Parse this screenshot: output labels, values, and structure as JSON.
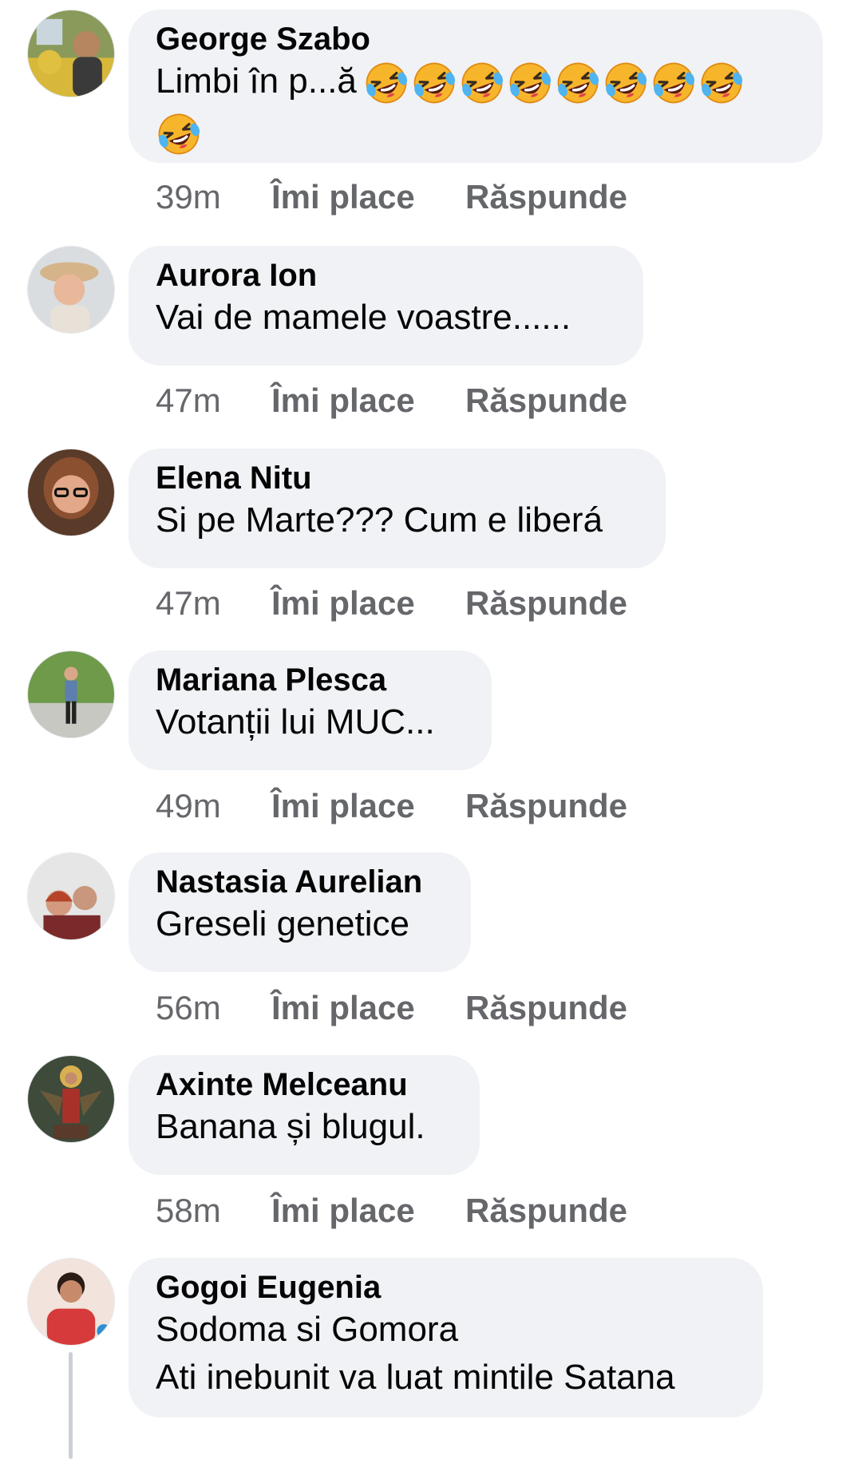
{
  "comments": [
    {
      "author": "George Szabo",
      "text": "Limbi în p...ă",
      "emoji_icon": "rolling-on-floor-laughing-emoji",
      "emoji_count": 9,
      "time": "39m",
      "like_label": "Îmi place",
      "reply_label": "Răspunde"
    },
    {
      "author": "Aurora Ion",
      "text": "Vai de mamele voastre......",
      "time": "47m",
      "like_label": "Îmi place",
      "reply_label": "Răspunde"
    },
    {
      "author": "Elena Nitu",
      "text": "Si pe Marte??? Cum e liberá",
      "time": "47m",
      "like_label": "Îmi place",
      "reply_label": "Răspunde"
    },
    {
      "author": "Mariana Plesca",
      "text": "Votanții lui MUC...",
      "time": "49m",
      "like_label": "Îmi place",
      "reply_label": "Răspunde"
    },
    {
      "author": "Nastasia Aurelian",
      "text": "Greseli genetice",
      "time": "56m",
      "like_label": "Îmi place",
      "reply_label": "Răspunde"
    },
    {
      "author": "Axinte Melceanu",
      "text": "Banana și blugul.",
      "time": "58m",
      "like_label": "Îmi place",
      "reply_label": "Răspunde"
    },
    {
      "author": "Gogoi Eugenia",
      "text": "Sodoma si Gomora",
      "text2": "Ati inebunit va luat mintile Satana"
    }
  ],
  "colors": {
    "bubble_bg": "#f0f2f5",
    "meta_text": "#65676b",
    "body_text": "#050505"
  }
}
